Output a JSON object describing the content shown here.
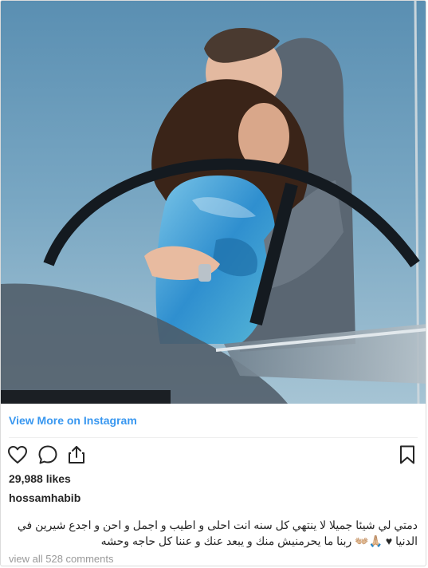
{
  "post": {
    "image_alt": "",
    "view_more": "View More on Instagram",
    "likes": "29,988 likes",
    "username": "hossamhabib",
    "caption_line1": "دمتي لي شيئا جميلا لا ينتهي كل سنه انت احلى و اطيب و اجمل و احن و اجدع شيرين في",
    "caption_line2": "الدنيا ♥ 🙏🏼👐🏼 ربنا ما يحرمنيش منك و يبعد عنك و عننا كل حاجه وحشه",
    "comments": "view all 528 comments"
  },
  "icons": {
    "like": "heart-icon",
    "comment": "comment-bubble-icon",
    "share": "share-icon",
    "save": "bookmark-icon"
  },
  "colors": {
    "link": "#3897f0",
    "text": "#262626",
    "muted": "#999999",
    "border": "#dbdbdb"
  }
}
